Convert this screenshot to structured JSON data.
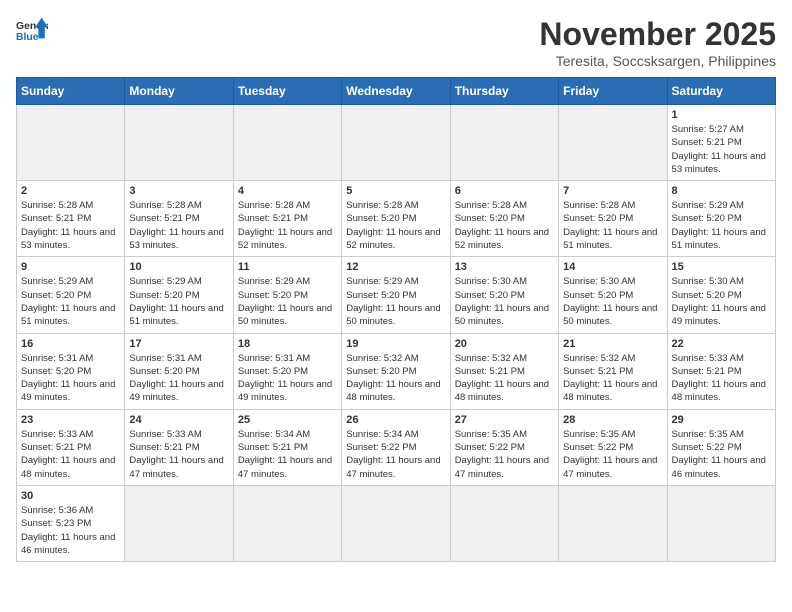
{
  "header": {
    "logo_general": "General",
    "logo_blue": "Blue",
    "title": "November 2025",
    "subtitle": "Teresita, Soccsksargen, Philippines"
  },
  "days_of_week": [
    "Sunday",
    "Monday",
    "Tuesday",
    "Wednesday",
    "Thursday",
    "Friday",
    "Saturday"
  ],
  "weeks": [
    {
      "cells": [
        {
          "day": null,
          "empty": true
        },
        {
          "day": null,
          "empty": true
        },
        {
          "day": null,
          "empty": true
        },
        {
          "day": null,
          "empty": true
        },
        {
          "day": null,
          "empty": true
        },
        {
          "day": null,
          "empty": true
        },
        {
          "day": "1",
          "sunrise": "5:27 AM",
          "sunset": "5:21 PM",
          "daylight": "11 hours and 53 minutes."
        }
      ]
    },
    {
      "cells": [
        {
          "day": "2",
          "sunrise": "5:28 AM",
          "sunset": "5:21 PM",
          "daylight": "11 hours and 53 minutes."
        },
        {
          "day": "3",
          "sunrise": "5:28 AM",
          "sunset": "5:21 PM",
          "daylight": "11 hours and 53 minutes."
        },
        {
          "day": "4",
          "sunrise": "5:28 AM",
          "sunset": "5:21 PM",
          "daylight": "11 hours and 52 minutes."
        },
        {
          "day": "5",
          "sunrise": "5:28 AM",
          "sunset": "5:20 PM",
          "daylight": "11 hours and 52 minutes."
        },
        {
          "day": "6",
          "sunrise": "5:28 AM",
          "sunset": "5:20 PM",
          "daylight": "11 hours and 52 minutes."
        },
        {
          "day": "7",
          "sunrise": "5:28 AM",
          "sunset": "5:20 PM",
          "daylight": "11 hours and 51 minutes."
        },
        {
          "day": "8",
          "sunrise": "5:29 AM",
          "sunset": "5:20 PM",
          "daylight": "11 hours and 51 minutes."
        }
      ]
    },
    {
      "cells": [
        {
          "day": "9",
          "sunrise": "5:29 AM",
          "sunset": "5:20 PM",
          "daylight": "11 hours and 51 minutes."
        },
        {
          "day": "10",
          "sunrise": "5:29 AM",
          "sunset": "5:20 PM",
          "daylight": "11 hours and 51 minutes."
        },
        {
          "day": "11",
          "sunrise": "5:29 AM",
          "sunset": "5:20 PM",
          "daylight": "11 hours and 50 minutes."
        },
        {
          "day": "12",
          "sunrise": "5:29 AM",
          "sunset": "5:20 PM",
          "daylight": "11 hours and 50 minutes."
        },
        {
          "day": "13",
          "sunrise": "5:30 AM",
          "sunset": "5:20 PM",
          "daylight": "11 hours and 50 minutes."
        },
        {
          "day": "14",
          "sunrise": "5:30 AM",
          "sunset": "5:20 PM",
          "daylight": "11 hours and 50 minutes."
        },
        {
          "day": "15",
          "sunrise": "5:30 AM",
          "sunset": "5:20 PM",
          "daylight": "11 hours and 49 minutes."
        }
      ]
    },
    {
      "cells": [
        {
          "day": "16",
          "sunrise": "5:31 AM",
          "sunset": "5:20 PM",
          "daylight": "11 hours and 49 minutes."
        },
        {
          "day": "17",
          "sunrise": "5:31 AM",
          "sunset": "5:20 PM",
          "daylight": "11 hours and 49 minutes."
        },
        {
          "day": "18",
          "sunrise": "5:31 AM",
          "sunset": "5:20 PM",
          "daylight": "11 hours and 49 minutes."
        },
        {
          "day": "19",
          "sunrise": "5:32 AM",
          "sunset": "5:20 PM",
          "daylight": "11 hours and 48 minutes."
        },
        {
          "day": "20",
          "sunrise": "5:32 AM",
          "sunset": "5:21 PM",
          "daylight": "11 hours and 48 minutes."
        },
        {
          "day": "21",
          "sunrise": "5:32 AM",
          "sunset": "5:21 PM",
          "daylight": "11 hours and 48 minutes."
        },
        {
          "day": "22",
          "sunrise": "5:33 AM",
          "sunset": "5:21 PM",
          "daylight": "11 hours and 48 minutes."
        }
      ]
    },
    {
      "cells": [
        {
          "day": "23",
          "sunrise": "5:33 AM",
          "sunset": "5:21 PM",
          "daylight": "11 hours and 48 minutes."
        },
        {
          "day": "24",
          "sunrise": "5:33 AM",
          "sunset": "5:21 PM",
          "daylight": "11 hours and 47 minutes."
        },
        {
          "day": "25",
          "sunrise": "5:34 AM",
          "sunset": "5:21 PM",
          "daylight": "11 hours and 47 minutes."
        },
        {
          "day": "26",
          "sunrise": "5:34 AM",
          "sunset": "5:22 PM",
          "daylight": "11 hours and 47 minutes."
        },
        {
          "day": "27",
          "sunrise": "5:35 AM",
          "sunset": "5:22 PM",
          "daylight": "11 hours and 47 minutes."
        },
        {
          "day": "28",
          "sunrise": "5:35 AM",
          "sunset": "5:22 PM",
          "daylight": "11 hours and 47 minutes."
        },
        {
          "day": "29",
          "sunrise": "5:35 AM",
          "sunset": "5:22 PM",
          "daylight": "11 hours and 46 minutes."
        }
      ]
    },
    {
      "cells": [
        {
          "day": "30",
          "sunrise": "5:36 AM",
          "sunset": "5:23 PM",
          "daylight": "11 hours and 46 minutes."
        },
        {
          "day": null,
          "empty": true
        },
        {
          "day": null,
          "empty": true
        },
        {
          "day": null,
          "empty": true
        },
        {
          "day": null,
          "empty": true
        },
        {
          "day": null,
          "empty": true
        },
        {
          "day": null,
          "empty": true
        }
      ]
    }
  ],
  "labels": {
    "sunrise": "Sunrise:",
    "sunset": "Sunset:",
    "daylight": "Daylight:"
  }
}
